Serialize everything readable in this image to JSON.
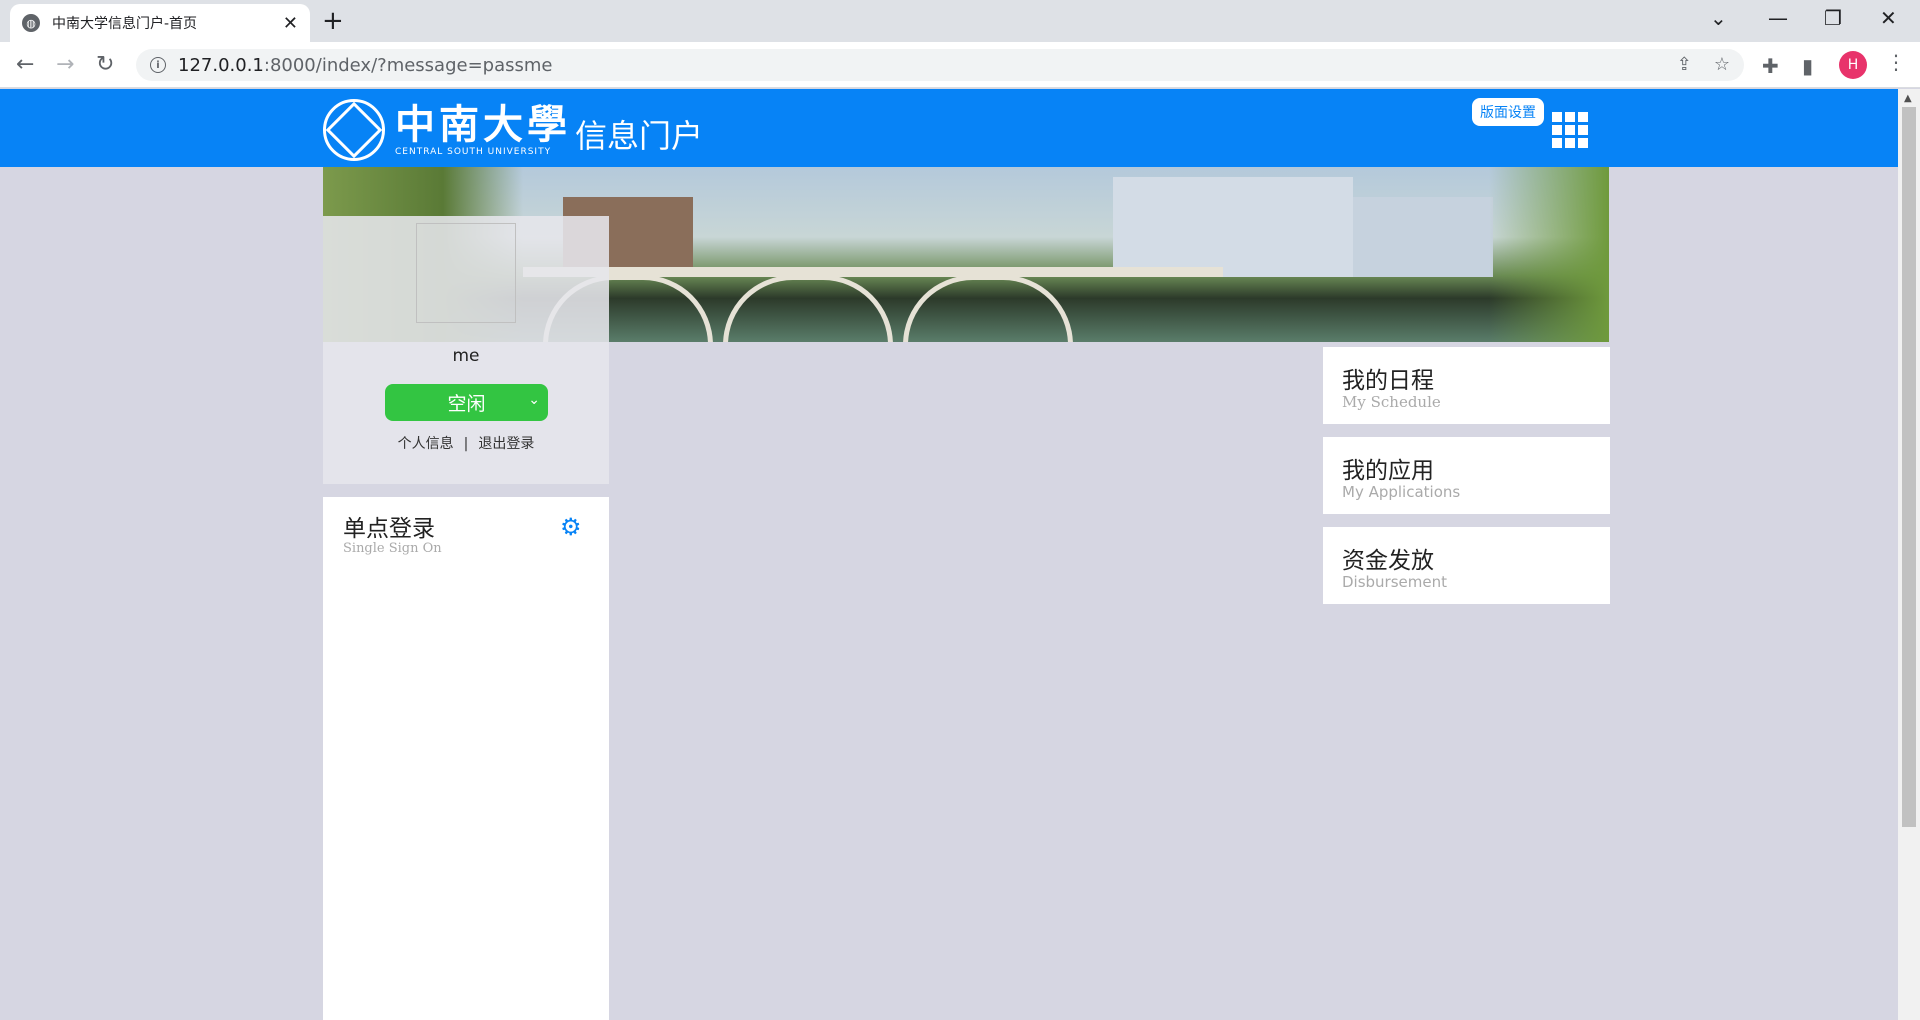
{
  "browser": {
    "tab_title": "中南大学信息门户-首页",
    "url_host": "127.0.0.1",
    "url_path": ":8000/index/?message=passme",
    "profile_initial": "H"
  },
  "header": {
    "logo_cn": "中南大學",
    "logo_en": "CENTRAL SOUTH UNIVERSITY",
    "portal_title": "信息门户",
    "layout_settings": "版面设置"
  },
  "profile": {
    "username": "me",
    "status": "空闲",
    "link_info": "个人信息",
    "separator": "|",
    "link_logout": "退出登录"
  },
  "sso": {
    "title": "单点登录",
    "subtitle": "Single Sign On"
  },
  "cards": [
    {
      "title": "我的日程",
      "subtitle": "My Schedule"
    },
    {
      "title": "我的应用",
      "subtitle": "My Applications"
    },
    {
      "title": "资金发放",
      "subtitle": "Disbursement"
    }
  ]
}
